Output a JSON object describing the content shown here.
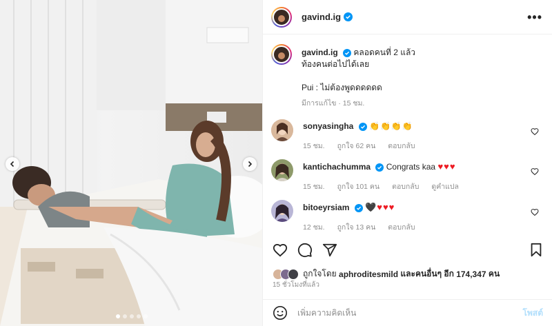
{
  "post": {
    "username": "gavind.ig",
    "more_label": "•••"
  },
  "caption": {
    "username": "gavind.ig",
    "line1": "คลอดคนที่ 2 แล้ว",
    "line2": "ท้องคนต่อไปได้เลย",
    "line3": "Pui : ไม่ต้องพูดดดดดด",
    "edited": "มีการแก้ไข · 15 ชม."
  },
  "comments": [
    {
      "username": "sonyasingha",
      "text": "👏👏👏👏",
      "time": "15 ชม.",
      "likes": "ถูกใจ 62 คน",
      "reply": "ตอบกลับ",
      "avatar_color": "#e7c3a9"
    },
    {
      "username": "kantichachumma",
      "text": "Congrats kaa",
      "hearts": "♥♥♥",
      "time": "15 ชม.",
      "likes": "ถูกใจ 101 คน",
      "reply": "ตอบกลับ",
      "translate": "ดูคำแปล",
      "avatar_color": "#7a8b5a"
    },
    {
      "username": "bitoeyrsiam",
      "hearts": "🖤♥♥♥",
      "time": "12 ชม.",
      "likes": "ถูกใจ 13 คน",
      "reply": "ตอบกลับ",
      "avatar_color": "#a7a3c9"
    }
  ],
  "likes_line": {
    "prefix": "ถูกใจโดย",
    "user": "aphroditesmild",
    "middle": "และคนอื่นๆ อีก",
    "count": "174,347",
    "suffix": "คน"
  },
  "time_ago": "15 ชั่วโมงที่แล้ว",
  "add_comment": {
    "placeholder": "เพิ่มความคิดเห็น",
    "post_label": "โพสต์"
  },
  "carousel": {
    "total": 5,
    "active_index": 0
  },
  "colors": {
    "verified": "#0095f6",
    "link": "#b2dffc",
    "meta": "#8e8e8e"
  },
  "icons": [
    "heart-icon",
    "comment-icon",
    "share-icon",
    "bookmark-icon",
    "emoji-icon",
    "chevron-left-icon",
    "chevron-right-icon",
    "verified-icon"
  ]
}
